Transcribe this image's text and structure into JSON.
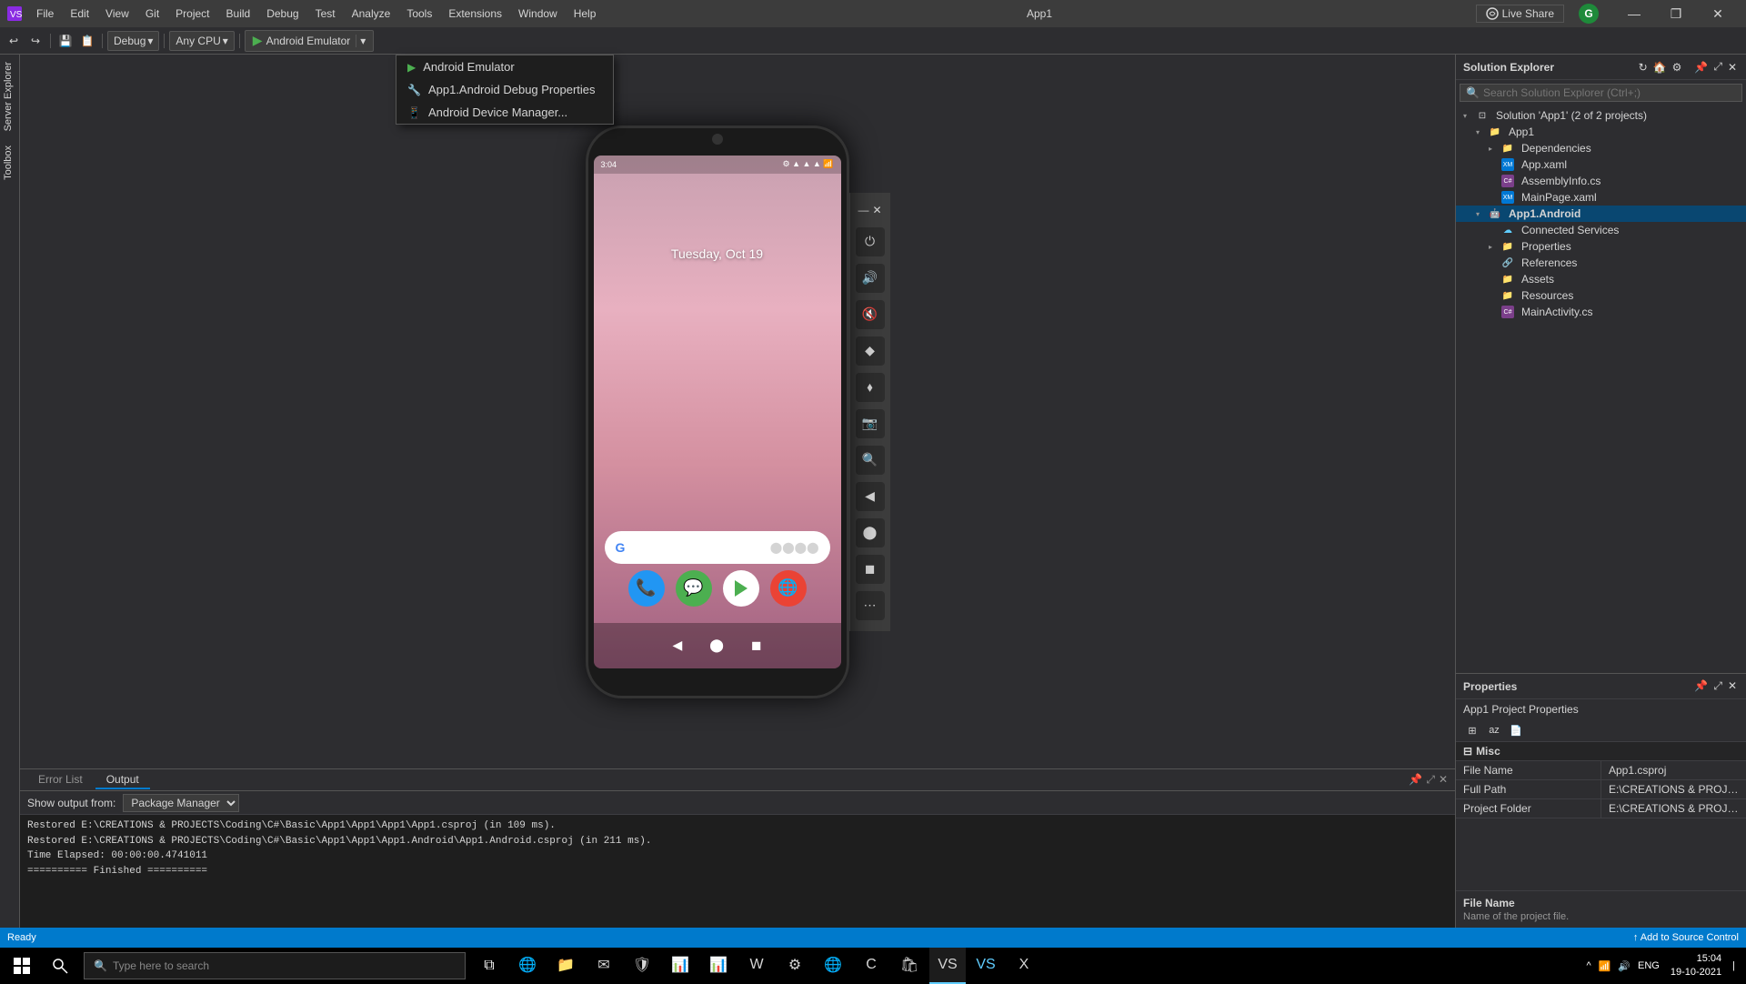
{
  "titleBar": {
    "appName": "App1",
    "liveshare": "Live Share",
    "userInitial": "G",
    "winMin": "—",
    "winMax": "❐",
    "winClose": "✕"
  },
  "menuBar": {
    "items": [
      "File",
      "Edit",
      "View",
      "Git",
      "Project",
      "Build",
      "Debug",
      "Test",
      "Analyze",
      "Tools",
      "Extensions",
      "Window",
      "Help"
    ]
  },
  "toolbar": {
    "debugMode": "Debug",
    "platform": "Any CPU",
    "runLabel": "Android Emulator",
    "dropdownArrow": "▾"
  },
  "dropdown": {
    "items": [
      {
        "label": "Android Emulator",
        "type": "run"
      },
      {
        "label": "App1.Android Debug Properties",
        "type": "wrench"
      },
      {
        "label": "Android Device Manager...",
        "type": "device"
      }
    ]
  },
  "emulator": {
    "time": "3:04",
    "date": "Tuesday, Oct 19",
    "topControls": [
      "⏻",
      "🔊",
      "🔇",
      "◆",
      "⬧",
      "📷",
      "🔍",
      "◀",
      "⬤",
      "◼",
      "⋯"
    ]
  },
  "output": {
    "title": "Output",
    "showFrom": "Show output from:",
    "source": "Package Manager",
    "lines": [
      "Restored E:\\CREATIONS & PROJECTS\\Coding\\C#\\Basic\\App1\\App1\\App1\\App1.csproj (in 109 ms).",
      "Restored E:\\CREATIONS & PROJECTS\\Coding\\C#\\Basic\\App1\\App1\\App1.Android\\App1.Android.csproj (in 211 ms).",
      "Time Elapsed: 00:00:00.4741011",
      "========== Finished =========="
    ],
    "tabs": [
      "Error List",
      "Output"
    ]
  },
  "solutionExplorer": {
    "title": "Solution Explorer",
    "searchPlaceholder": "Search Solution Explorer (Ctrl+;)",
    "tree": [
      {
        "level": 0,
        "label": "Solution 'App1' (2 of 2 projects)",
        "type": "solution",
        "expanded": true
      },
      {
        "level": 1,
        "label": "App1",
        "type": "folder",
        "expanded": true
      },
      {
        "level": 2,
        "label": "Dependencies",
        "type": "folder",
        "expanded": false
      },
      {
        "level": 2,
        "label": "App.xaml",
        "type": "xaml"
      },
      {
        "level": 2,
        "label": "AssemblyInfo.cs",
        "type": "cs"
      },
      {
        "level": 2,
        "label": "MainPage.xaml",
        "type": "xaml"
      },
      {
        "level": 1,
        "label": "App1.Android",
        "type": "android",
        "expanded": true,
        "selected": true
      },
      {
        "level": 2,
        "label": "Connected Services",
        "type": "service"
      },
      {
        "level": 2,
        "label": "Properties",
        "type": "folder",
        "expanded": false
      },
      {
        "level": 2,
        "label": "References",
        "type": "ref"
      },
      {
        "level": 2,
        "label": "Assets",
        "type": "folder"
      },
      {
        "level": 2,
        "label": "Resources",
        "type": "folder"
      },
      {
        "level": 2,
        "label": "MainActivity.cs",
        "type": "cs"
      }
    ]
  },
  "properties": {
    "title": "Properties",
    "subtitle": "App1  Project Properties",
    "sections": [
      {
        "name": "Misc",
        "rows": [
          {
            "key": "File Name",
            "value": "App1.csproj"
          },
          {
            "key": "Full Path",
            "value": "E:\\CREATIONS & PROJECTS\\Codin"
          },
          {
            "key": "Project Folder",
            "value": "E:\\CREATIONS & PROJECTS\\Codin"
          }
        ]
      }
    ],
    "footer": {
      "title": "File Name",
      "desc": "Name of the project file."
    }
  },
  "statusBar": {
    "ready": "Ready",
    "addToSourceControl": "↑ Add to Source Control"
  },
  "taskbar": {
    "searchPlaceholder": "Type here to search",
    "clock": {
      "time": "15:04",
      "date": "19-10-2021"
    },
    "lang": "ENG"
  },
  "sidebar": {
    "items": [
      "Server Explorer",
      "Toolbox"
    ]
  }
}
